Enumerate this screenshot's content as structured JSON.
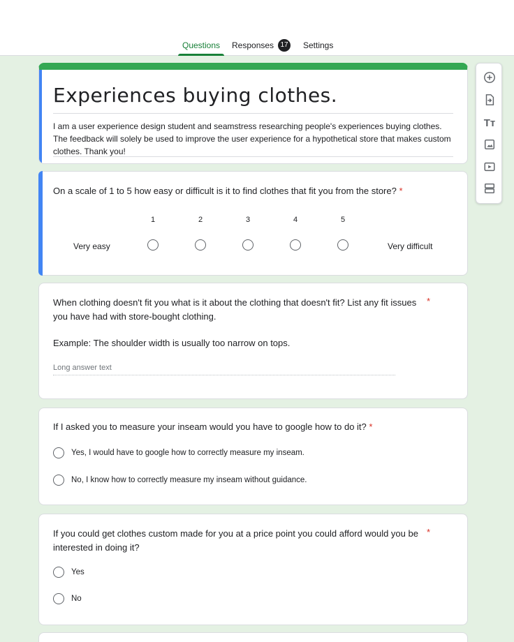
{
  "tabs": {
    "questions": "Questions",
    "responses": "Responses",
    "responses_count": "17",
    "settings": "Settings"
  },
  "colors": {
    "accent_green": "#34a853",
    "active_tab": "#188038",
    "accent_blue": "#4285f4",
    "required": "#d93025",
    "background": "#e4f1e3"
  },
  "form": {
    "title": "Experiences buying clothes.",
    "description": "I am a user experience design student and seamstress researching people's experiences buying clothes. The feedback will solely be used to improve the user experience for a hypothetical store that makes custom clothes. Thank you!"
  },
  "questions": [
    {
      "text": "On a scale of 1 to 5 how easy or difficult is it to find clothes that fit you from the store?",
      "required": "*",
      "scale": [
        "1",
        "2",
        "3",
        "4",
        "5"
      ],
      "low_label": "Very easy",
      "high_label": "Very difficult"
    },
    {
      "text": "When clothing doesn't fit you what is it about the clothing that doesn't fit? List any fit issues you have had with store-bought clothing.",
      "example": "Example: The shoulder width is usually too narrow on tops.",
      "required": "*",
      "placeholder": "Long answer text"
    },
    {
      "text": "If I asked you to measure your inseam would you have to google how to do it?",
      "required": "*",
      "options": [
        "Yes, I would have to google how to correctly measure my inseam.",
        "No, I know how to correctly measure my inseam without guidance."
      ]
    },
    {
      "text": "If you could get clothes custom made for you at a price point you could afford would you be interested in doing it?",
      "required": "*",
      "options": [
        "Yes",
        "No"
      ]
    }
  ],
  "toolbar": {
    "icons": [
      "add-question-icon",
      "import-questions-icon",
      "add-title-icon",
      "add-image-icon",
      "add-video-icon",
      "add-section-icon"
    ]
  }
}
